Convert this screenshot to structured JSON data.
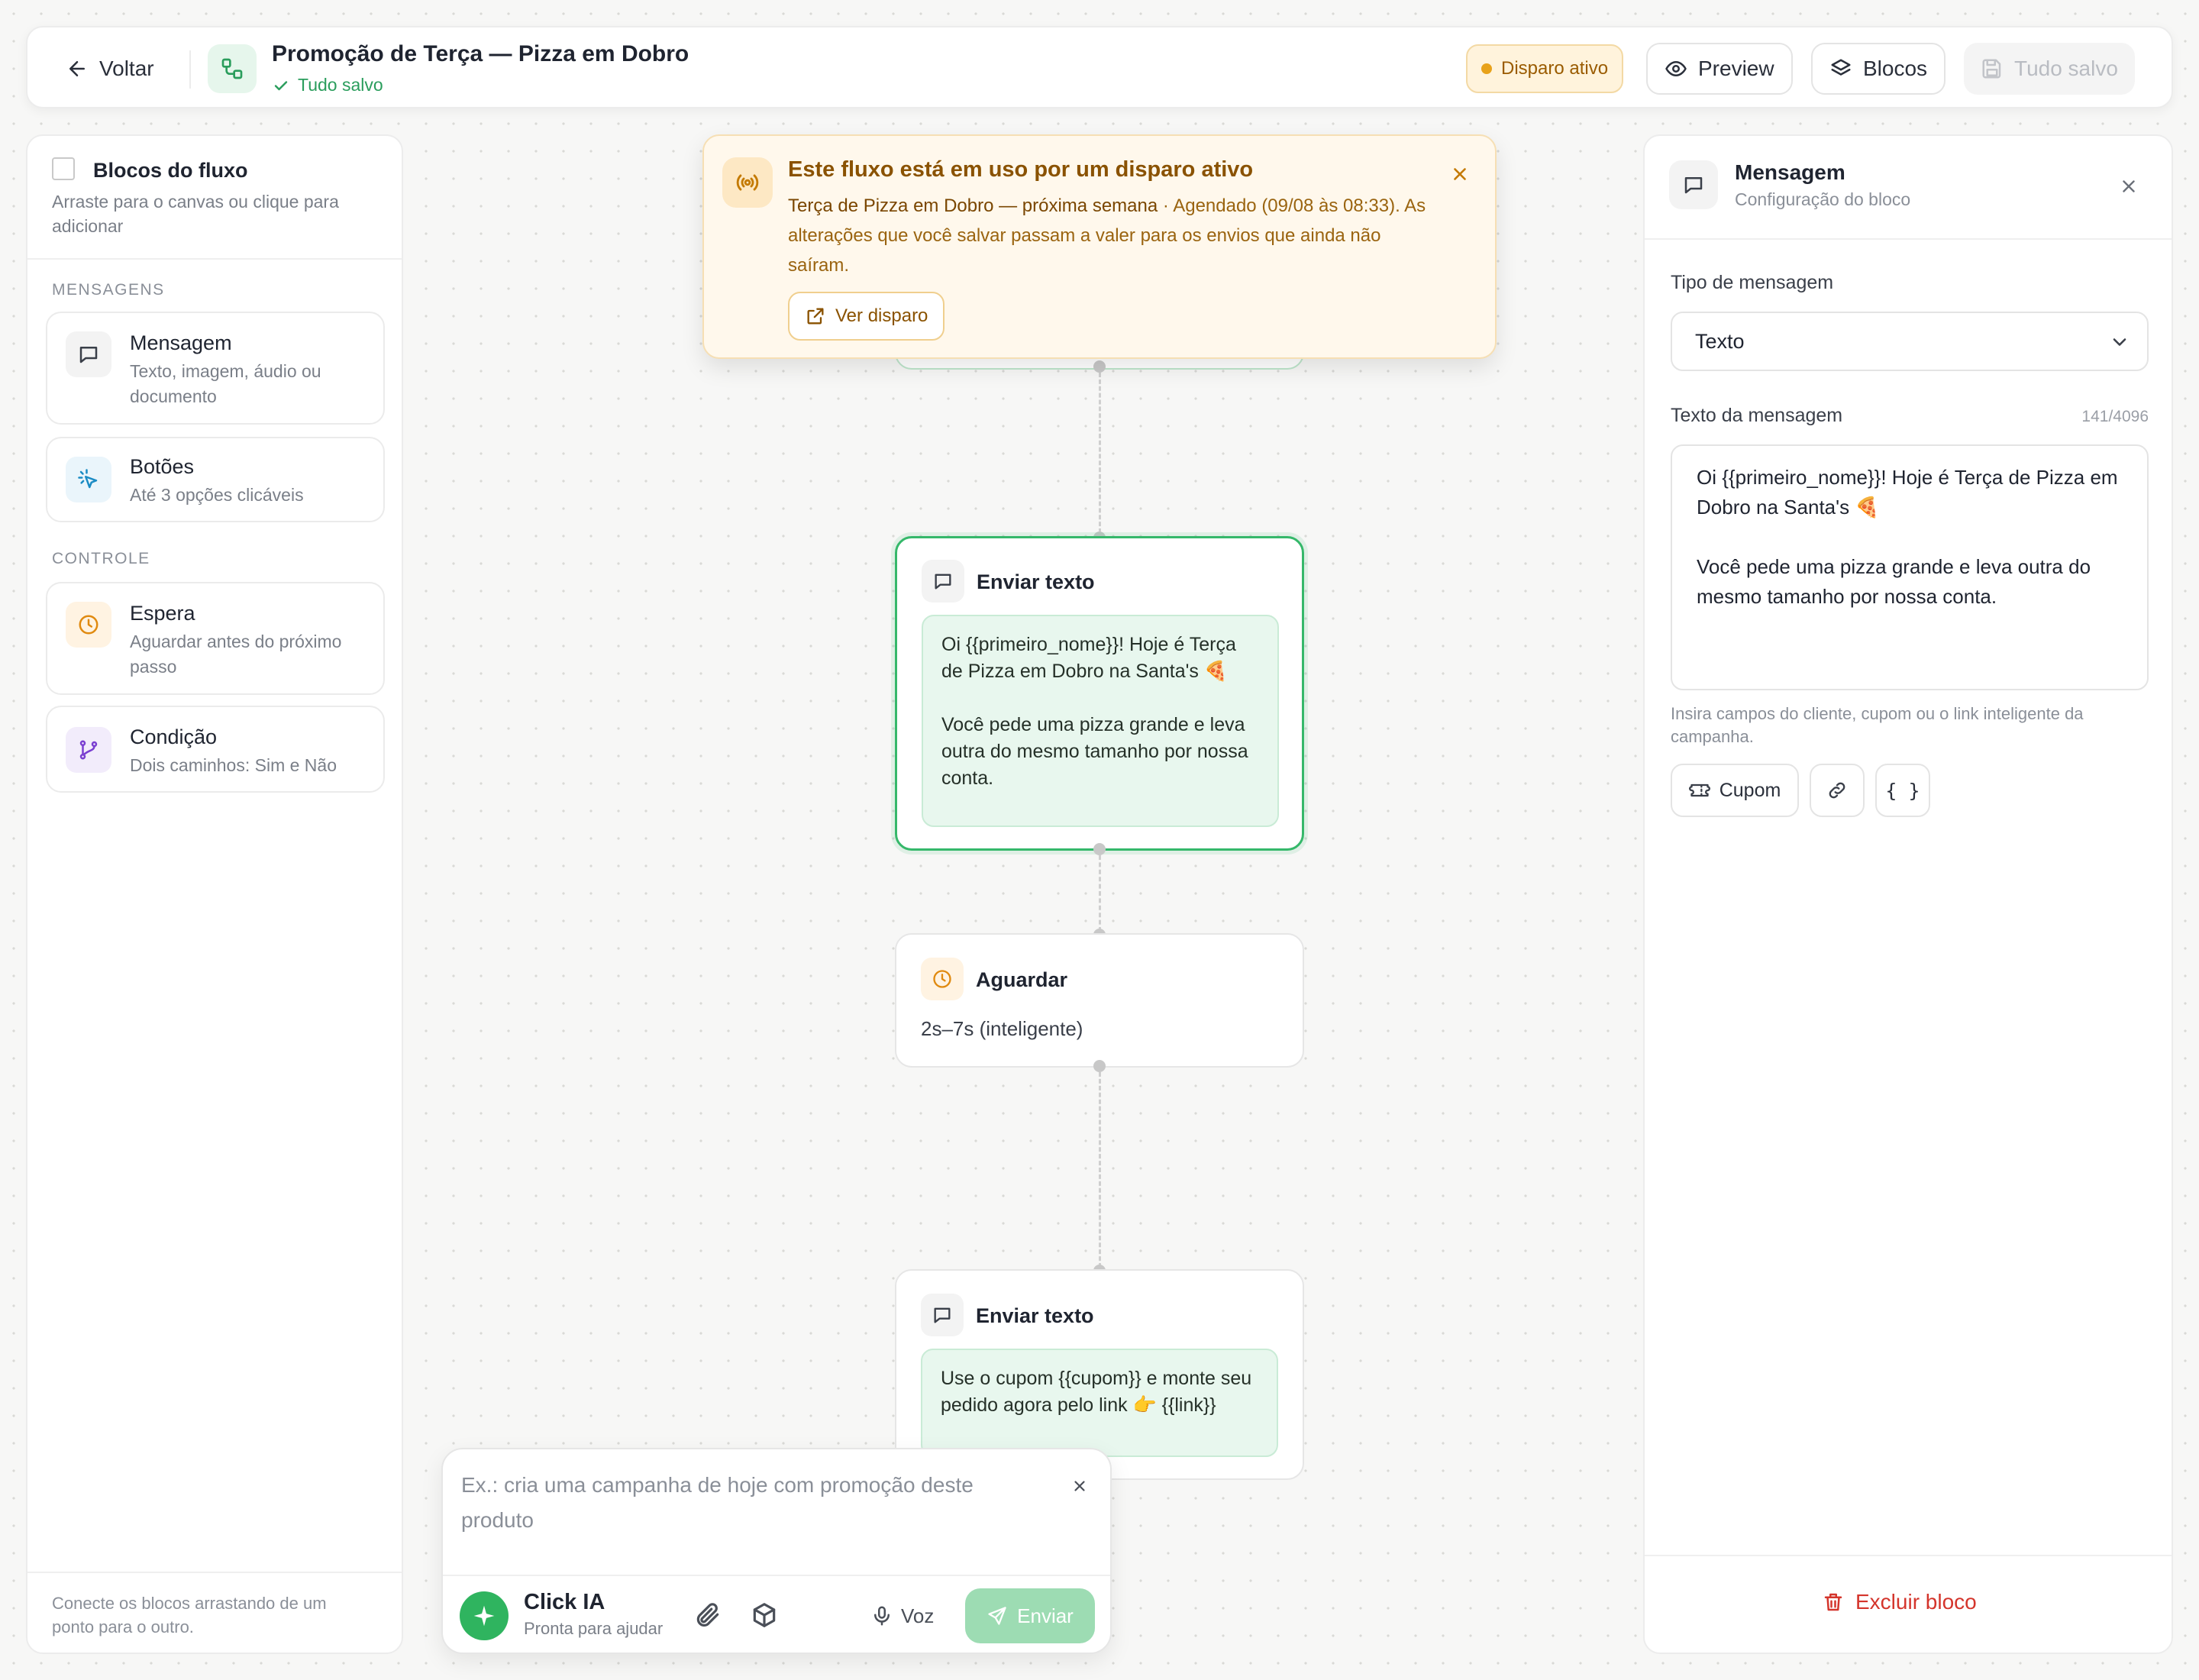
{
  "header": {
    "back_label": "Voltar",
    "title": "Promoção de Terça — Pizza em Dobro",
    "save_status": "Tudo salvo",
    "active_badge": "Disparo ativo",
    "preview_label": "Preview",
    "blocks_label": "Blocos",
    "saved_button_label": "Tudo salvo"
  },
  "sidebar": {
    "title": "Blocos do fluxo",
    "subtitle": "Arraste para o canvas ou clique para adicionar",
    "sections": [
      {
        "label": "MENSAGENS",
        "items": [
          {
            "title": "Mensagem",
            "desc": "Texto, imagem, áudio ou documento",
            "icon": "message-icon"
          },
          {
            "title": "Botões",
            "desc": "Até 3 opções clicáveis",
            "icon": "pointer-click-icon"
          }
        ]
      },
      {
        "label": "CONTROLE",
        "items": [
          {
            "title": "Espera",
            "desc": "Aguardar antes do próximo passo",
            "icon": "clock-icon"
          },
          {
            "title": "Condição",
            "desc": "Dois caminhos: Sim e Não",
            "icon": "branch-icon"
          }
        ]
      }
    ],
    "footer": "Conecte os blocos arrastando de um ponto para o outro."
  },
  "banner": {
    "title": "Este fluxo está em uso por um disparo ativo",
    "campaign": "Terça de Pizza em Dobro — próxima semana",
    "body": " · Agendado (09/08 às 08:33). As alterações que você salvar passam a valer para os envios que ainda não saíram.",
    "button_label": "Ver disparo"
  },
  "canvas": {
    "nodes": [
      {
        "title": "Enviar texto",
        "text": "Oi {{primeiro_nome}}! Hoje é Terça de Pizza em Dobro na Santa's 🍕\n\nVocê pede uma pizza grande e leva outra do mesmo tamanho por nossa conta."
      },
      {
        "title": "Aguardar",
        "text": "2s–7s (inteligente)"
      },
      {
        "title": "Enviar texto",
        "text": "Use o cupom {{cupom}} e monte seu pedido agora pelo link 👉 {{link}}"
      }
    ]
  },
  "panel": {
    "title": "Mensagem",
    "subtitle": "Configuração do bloco",
    "type_label": "Tipo de mensagem",
    "type_value": "Texto",
    "text_label": "Texto da mensagem",
    "char_count": "141/4096",
    "text_value": "Oi {{primeiro_nome}}! Hoje é Terça de Pizza em Dobro na Santa's 🍕\n\nVocê pede uma pizza grande e leva outra do mesmo tamanho por nossa conta.",
    "helper": "Insira campos do cliente, cupom ou o link inteligente da campanha.",
    "coupon_label": "Cupom",
    "braces_label": "{ }",
    "delete_label": "Excluir bloco"
  },
  "ai": {
    "placeholder": "Ex.: cria uma campanha de hoje com promoção deste produto",
    "name": "Click IA",
    "status": "Pronta para ajudar",
    "voice_label": "Voz",
    "send_label": "Enviar"
  },
  "colors": {
    "accent_green": "#35b86a",
    "warning_orange": "#e8a21a",
    "danger_red": "#d4352c"
  }
}
